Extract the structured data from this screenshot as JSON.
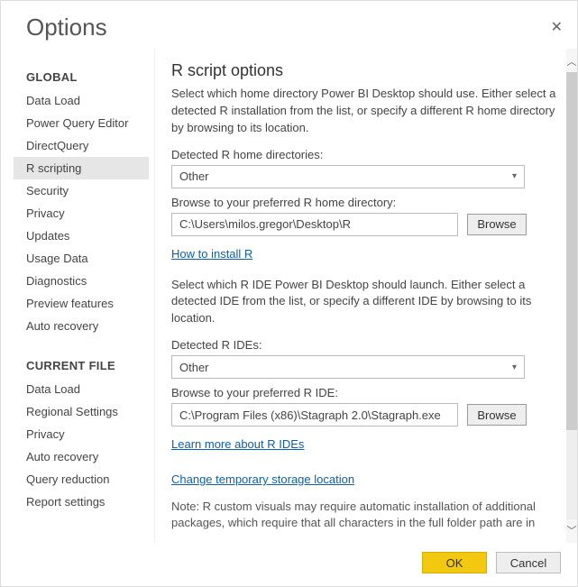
{
  "window": {
    "title": "Options"
  },
  "sidebar": {
    "global_header": "GLOBAL",
    "global_items": [
      "Data Load",
      "Power Query Editor",
      "DirectQuery",
      "R scripting",
      "Security",
      "Privacy",
      "Updates",
      "Usage Data",
      "Diagnostics",
      "Preview features",
      "Auto recovery"
    ],
    "global_selected_index": 3,
    "current_header": "CURRENT FILE",
    "current_items": [
      "Data Load",
      "Regional Settings",
      "Privacy",
      "Auto recovery",
      "Query reduction",
      "Report settings"
    ]
  },
  "panel": {
    "heading": "R script options",
    "intro": "Select which home directory Power BI Desktop should use. Either select a detected R installation from the list, or specify a different R home directory by browsing to its location.",
    "detected_home_label": "Detected R home directories:",
    "detected_home_value": "Other",
    "browse_home_label": "Browse to your preferred R home directory:",
    "browse_home_value": "C:\\Users\\milos.gregor\\Desktop\\R",
    "browse_btn": "Browse",
    "install_link": "How to install R",
    "ide_intro": "Select which R IDE Power BI Desktop should launch. Either select a detected IDE from the list, or specify a different IDE by browsing to its location.",
    "detected_ide_label": "Detected R IDEs:",
    "detected_ide_value": "Other",
    "browse_ide_label": "Browse to your preferred R IDE:",
    "browse_ide_value": "C:\\Program Files (x86)\\Stagraph 2.0\\Stagraph.exe",
    "ide_link": "Learn more about R IDEs",
    "storage_link": "Change temporary storage location",
    "note": "Note: R custom visuals may require automatic installation of additional packages, which require that all characters in the full folder path are in"
  },
  "footer": {
    "ok": "OK",
    "cancel": "Cancel"
  }
}
